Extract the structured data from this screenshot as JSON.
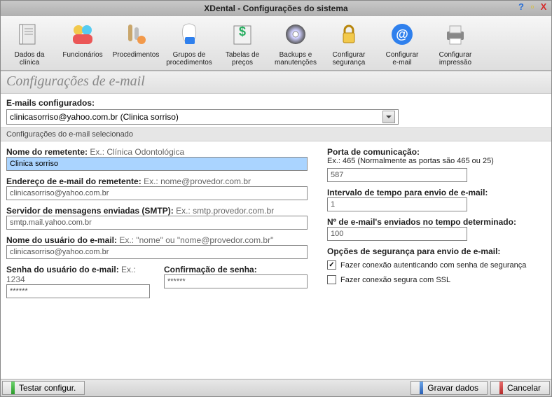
{
  "title": "XDental - Configurações do sistema",
  "toolbar": [
    {
      "id": "dados-clinica",
      "label": "Dados da\nclínica"
    },
    {
      "id": "funcionarios",
      "label": "Funcionários"
    },
    {
      "id": "procedimentos",
      "label": "Procedimentos"
    },
    {
      "id": "grupos-proc",
      "label": "Grupos de\nprocedimentos"
    },
    {
      "id": "tabelas-precos",
      "label": "Tabelas de\npreços"
    },
    {
      "id": "backups",
      "label": "Backups e\nmanutenções"
    },
    {
      "id": "config-seguranca",
      "label": "Configurar\nsegurança"
    },
    {
      "id": "config-email",
      "label": "Configurar\ne-mail"
    },
    {
      "id": "config-impressao",
      "label": "Configurar\nimpressão"
    }
  ],
  "page_title": "Configurações de e-mail",
  "emails_label": "E-mails configurados:",
  "selected_email": "clinicasorriso@yahoo.com.br (Clinica sorriso)",
  "subheader": "Configurações do e-mail selecionado",
  "left": {
    "remetente_label": "Nome do remetente:",
    "remetente_hint": "Ex.: Clínica Odontológica",
    "remetente_value": "Clinica sorriso",
    "endereco_label": "Endereço de e-mail do remetente:",
    "endereco_hint": "Ex.: nome@provedor.com.br",
    "endereco_value": "clinicasorriso@yahoo.com.br",
    "smtp_label": "Servidor de mensagens enviadas (SMTP):",
    "smtp_hint": "Ex.: smtp.provedor.com.br",
    "smtp_value": "smtp.mail.yahoo.com.br",
    "usuario_label": "Nome do usuário do e-mail:",
    "usuario_hint": "Ex.: \"nome\" ou \"nome@provedor.com.br\"",
    "usuario_value": "clinicasorriso@yahoo.com.br",
    "senha_label": "Senha do usuário do e-mail:",
    "senha_hint": "Ex.: 1234",
    "senha_value": "******",
    "confirma_label": "Confirmação de senha:",
    "confirma_value": "******"
  },
  "right": {
    "porta_label": "Porta de comunicação:",
    "porta_hint": "Ex.: 465 (Normalmente as portas são 465 ou 25)",
    "porta_value": "587",
    "intervalo_label": "Intervalo de tempo para envio de e-mail:",
    "intervalo_value": "1",
    "nenviados_label": "Nº de e-mail's enviados no tempo determinado:",
    "nenviados_value": "100",
    "opcoes_label": "Opções de segurança para envio de e-mail:",
    "cb1_label": "Fazer conexão autenticando com senha de segurança",
    "cb2_label": "Fazer conexão segura com SSL"
  },
  "footer": {
    "testar": "Testar configur.",
    "gravar": "Gravar dados",
    "cancelar": "Cancelar"
  }
}
